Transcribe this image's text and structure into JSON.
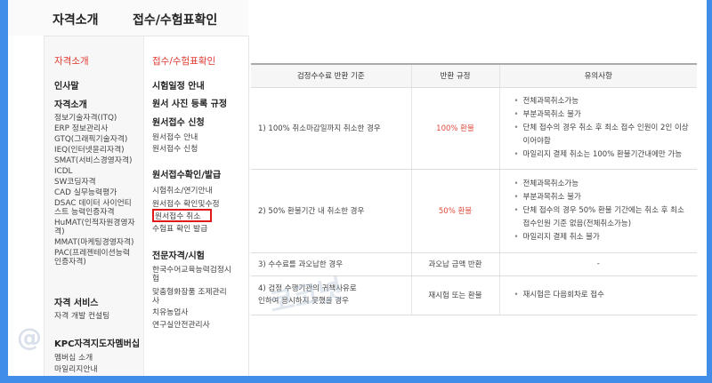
{
  "topnav": {
    "item1": "자격소개",
    "item2": "접수/수험표확인"
  },
  "col1": {
    "title": "자격소개",
    "sections": [
      {
        "label": "인사말"
      },
      {
        "label": "자격소개"
      },
      {
        "label": "자격 서비스"
      },
      {
        "label": "KPC자격지도자멤버십"
      }
    ],
    "cert_items": [
      "정보기술자격(ITQ)",
      "ERP 정보관리사",
      "GTQ(그래픽기술자격)",
      "IEQ(인터넷윤리자격)",
      "SMAT(서비스경영자격)",
      "ICDL",
      "SW코딩자격",
      "CAD 실무능력평가",
      "DSAC 데이터 사이언티",
      "스트 능력인증자격",
      "HuMAT(인적자원경영자",
      "격)",
      "MMAT(마케팅경영자격)",
      "PAC(프레젠테이션능력",
      "인증자격)"
    ],
    "service_items": [
      "자격 개발 컨설팅"
    ],
    "member_items": [
      "멤버십 소개",
      "마일리지안내"
    ]
  },
  "col2": {
    "title": "접수/수험표확인",
    "sections": [
      {
        "label": "시험일정 안내"
      },
      {
        "label": "원서 사진 등록 규정"
      },
      {
        "label": "원서접수 신청"
      },
      {
        "label": "원서접수확인/발급"
      },
      {
        "label": "전문자격/시험"
      }
    ],
    "apply_items": [
      "원서접수 안내",
      "원서접수 신청"
    ],
    "confirm_items": [
      "시험취소/연기안내",
      "원서접수 확인및수정",
      "원서접수 취소",
      "수험표 확인 발급"
    ],
    "pro_items": [
      "한국수어교육능력검정시",
      "험",
      "맞춤형화장품 조제관리",
      "사",
      "치유농업사",
      "연구실안전관리사"
    ]
  },
  "table": {
    "headers": [
      "검정수수료 반환 기준",
      "반환 규정",
      "유의사항"
    ],
    "rows": [
      {
        "criterion": "1) 100% 취소마감일까지 취소한 경우",
        "rule": "100% 환불",
        "notes": [
          "전체과목취소가능",
          "부분과목취소 불가",
          "단체 접수의 경우 취소 후 최소 접수 인원이 2인 이상이어야함",
          "마일리지 결제 취소는 100% 환불기간내에만 가능"
        ]
      },
      {
        "criterion": "2) 50% 환불기간 내 취소한 경우",
        "rule": "50% 환불",
        "notes": [
          "전체과목취소가능",
          "부분과목취소 불가",
          "단체 접수의 경우 50% 환불 기간에는 취소 후 최소 접수인원 기준 없음(전체취소가능)",
          "마일리지 결제 취소 불가"
        ]
      },
      {
        "criterion": "3) 수수료를 과오납한 경우",
        "rule": "과오납 금액 반환",
        "notes_text": "-"
      },
      {
        "criterion_line1": "4) 검정 수행기관의 귀책사유로",
        "criterion_line2": "인하여 응시하지 못했을 경우",
        "rule": "재시험 또는 환불",
        "notes": [
          "재시험은 다음회차로 접수"
        ]
      }
    ]
  },
  "watermark": {
    "text1": "@",
    "text2": "코코넛"
  },
  "colors": {
    "accent_red": "#e03a2f",
    "highlight_border": "#e01818",
    "background_blue": "#3f8de9"
  }
}
